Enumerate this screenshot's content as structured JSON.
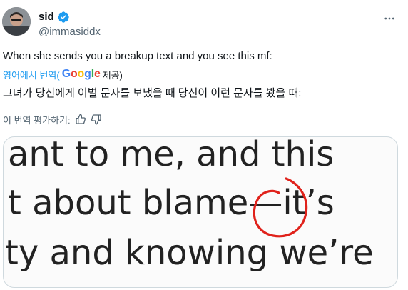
{
  "author": {
    "name": "sid",
    "handle": "@immasiddx",
    "verified_color": "#1d9bf0"
  },
  "tweet": {
    "text": "When she sends you a breakup text and you see this mf:",
    "translate_label": "영어에서 번역(",
    "translate_brand": "Google",
    "translate_suffix": " 제공)",
    "translated_text": "그녀가 당신에게 이별 문자를 보냈을 때 당신이 이런 문자를 봤을 때:",
    "rate_translation": "이 번역 평가하기:"
  },
  "media": {
    "lines": [
      "ant to me, and this",
      "t about blame—it’s",
      "ty and knowing we’re"
    ],
    "annotation_color": "#e0221b"
  },
  "icons": {
    "more": "more-horizontal-icon",
    "verified": "verified-badge-icon",
    "thumbs_up": "thumbs-up-icon",
    "thumbs_down": "thumbs-down-icon"
  }
}
